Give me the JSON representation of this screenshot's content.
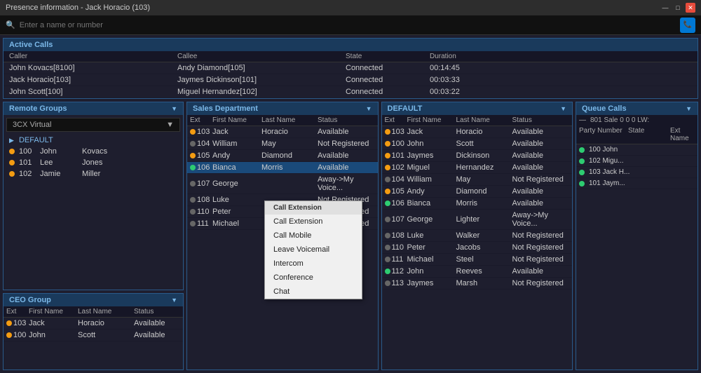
{
  "titleBar": {
    "title": "Presence information - Jack Horacio (103)",
    "minBtn": "—",
    "maxBtn": "□",
    "closeBtn": "✕"
  },
  "search": {
    "placeholder": "Enter a name or number"
  },
  "activeCalls": {
    "title": "Active Calls",
    "headers": [
      "Caller",
      "Callee",
      "State",
      "Duration"
    ],
    "rows": [
      {
        "caller": "John Kovacs[8100]",
        "callee": "Andy Diamond[105]",
        "state": "Connected",
        "duration": "00:14:45"
      },
      {
        "caller": "Jack Horacio[103]",
        "callee": "Jaymes Dickinson[101]",
        "state": "Connected",
        "duration": "00:03:33"
      },
      {
        "caller": "John Scott[100]",
        "callee": "Miguel Hernandez[102]",
        "state": "Connected",
        "duration": "00:03:22"
      }
    ]
  },
  "remoteGroups": {
    "title": "Remote Groups",
    "selectedGroup": "3CX Virtual",
    "groupLabel": "DEFAULT",
    "contacts": [
      {
        "ext": "100",
        "firstName": "John",
        "lastName": "Kovacs",
        "status": "yellow"
      },
      {
        "ext": "101",
        "firstName": "Lee",
        "lastName": "Jones",
        "status": "yellow"
      },
      {
        "ext": "102",
        "firstName": "Jamie",
        "lastName": "Miller",
        "status": "yellow"
      }
    ]
  },
  "salesDept": {
    "title": "Sales Department",
    "headers": [
      "Ext",
      "First Name",
      "Last Name",
      "Status"
    ],
    "rows": [
      {
        "ext": "103",
        "firstName": "Jack",
        "lastName": "Horacio",
        "status": "Available",
        "dot": "yellow"
      },
      {
        "ext": "104",
        "firstName": "William",
        "lastName": "May",
        "status": "Not Registered",
        "dot": "gray"
      },
      {
        "ext": "105",
        "firstName": "Andy",
        "lastName": "Diamond",
        "status": "Available",
        "dot": "yellow"
      },
      {
        "ext": "106",
        "firstName": "Bianca",
        "lastName": "Morris",
        "status": "Available",
        "dot": "green",
        "selected": true
      },
      {
        "ext": "107",
        "firstName": "George",
        "lastName": "",
        "status": "Away->My Voice...",
        "dot": "gray"
      },
      {
        "ext": "108",
        "firstName": "Luke",
        "lastName": "",
        "status": "Not Registered",
        "dot": "gray"
      },
      {
        "ext": "110",
        "firstName": "Peter",
        "lastName": "",
        "status": "Not Registered",
        "dot": "gray"
      },
      {
        "ext": "111",
        "firstName": "Michael",
        "lastName": "",
        "status": "Not Registered",
        "dot": "gray"
      }
    ]
  },
  "contextMenu": {
    "header": "Call Extension",
    "items": [
      "Call Extension",
      "Call Mobile",
      "Leave Voicemail",
      "Intercom",
      "Conference",
      "Chat"
    ]
  },
  "defaultGroup": {
    "title": "DEFAULT",
    "headers": [
      "Ext",
      "First Name",
      "Last Name",
      "Status"
    ],
    "rows": [
      {
        "ext": "103",
        "firstName": "Jack",
        "lastName": "Horacio",
        "status": "Available",
        "dot": "yellow"
      },
      {
        "ext": "100",
        "firstName": "John",
        "lastName": "Scott",
        "status": "Available",
        "dot": "yellow"
      },
      {
        "ext": "101",
        "firstName": "Jaymes",
        "lastName": "Dickinson",
        "status": "Available",
        "dot": "yellow"
      },
      {
        "ext": "102",
        "firstName": "Miguel",
        "lastName": "Hernandez",
        "status": "Available",
        "dot": "yellow"
      },
      {
        "ext": "104",
        "firstName": "William",
        "lastName": "May",
        "status": "Not Registered",
        "dot": "gray"
      },
      {
        "ext": "105",
        "firstName": "Andy",
        "lastName": "Diamond",
        "status": "Available",
        "dot": "yellow"
      },
      {
        "ext": "106",
        "firstName": "Bianca",
        "lastName": "Morris",
        "status": "Available",
        "dot": "green"
      },
      {
        "ext": "107",
        "firstName": "George",
        "lastName": "Lighter",
        "status": "Away->My Voice...",
        "dot": "gray"
      },
      {
        "ext": "108",
        "firstName": "Luke",
        "lastName": "Walker",
        "status": "Not Registered",
        "dot": "gray"
      },
      {
        "ext": "110",
        "firstName": "Peter",
        "lastName": "Jacobs",
        "status": "Not Registered",
        "dot": "gray"
      },
      {
        "ext": "111",
        "firstName": "Michael",
        "lastName": "Steel",
        "status": "Not Registered",
        "dot": "gray"
      },
      {
        "ext": "112",
        "firstName": "John",
        "lastName": "Reeves",
        "status": "Available",
        "dot": "green"
      },
      {
        "ext": "113",
        "firstName": "Jaymes",
        "lastName": "Marsh",
        "status": "Not Registered",
        "dot": "gray"
      }
    ]
  },
  "queueCalls": {
    "title": "Queue Calls",
    "bar": "801  Sale  0  0  0  LW:",
    "headers": [
      "Party Number",
      "State",
      "",
      "Ext  Name"
    ],
    "rows": [
      {
        "name": "100  John",
        "dot": "green"
      },
      {
        "name": "102  Migu...",
        "dot": "green"
      },
      {
        "name": "103  Jack H...",
        "dot": "green"
      },
      {
        "name": "101  Jaym...",
        "dot": "green"
      }
    ]
  },
  "ceoGroup": {
    "title": "CEO Group",
    "headers": [
      "Ext",
      "First Name",
      "Last Name",
      "Status"
    ],
    "rows": [
      {
        "ext": "103",
        "firstName": "Jack",
        "lastName": "Horacio",
        "status": "Available",
        "dot": "yellow"
      },
      {
        "ext": "100",
        "firstName": "John",
        "lastName": "Scott",
        "status": "Available",
        "dot": "yellow"
      }
    ]
  }
}
